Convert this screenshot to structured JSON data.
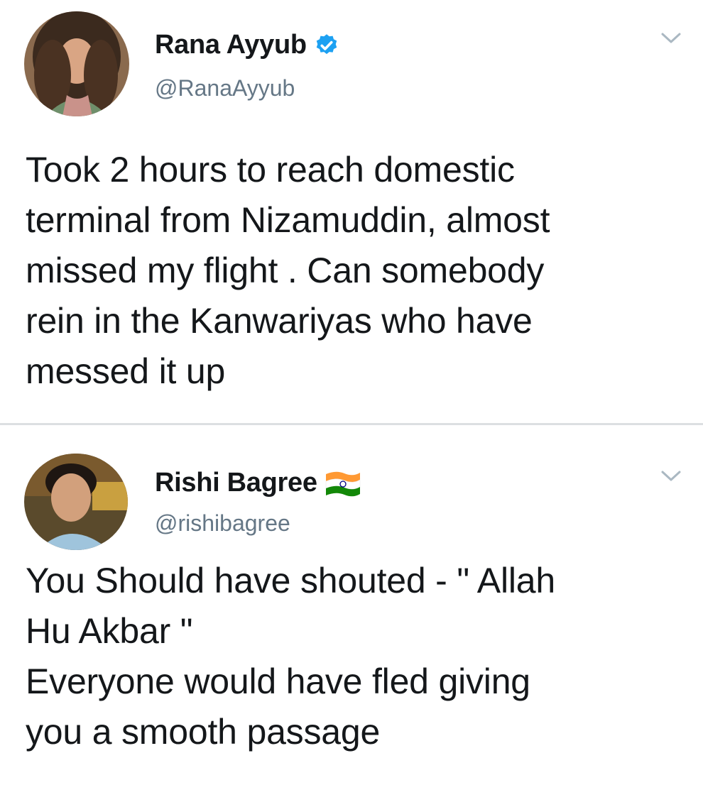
{
  "tweets": [
    {
      "display_name": "Rana Ayyub",
      "handle": "@RanaAyyub",
      "badge": "verified-badge-icon",
      "text": "Took 2 hours to reach domestic\nterminal from Nizamuddin, almost\nmissed my flight . Can somebody\nrein in the Kanwariyas who have\nmessed it up"
    },
    {
      "display_name": "Rishi Bagree",
      "handle": "@rishibagree",
      "badge": "india-flag-icon",
      "text": "You Should have shouted  - \" Allah\nHu Akbar \"\nEveryone would have fled giving\nyou a smooth passage"
    }
  ],
  "colors": {
    "verified": "#1da1f2",
    "handle": "#657786",
    "divider": "#dcdfe2",
    "flag_saffron": "#ff9933",
    "flag_green": "#138808",
    "flag_chakra": "#000080"
  }
}
